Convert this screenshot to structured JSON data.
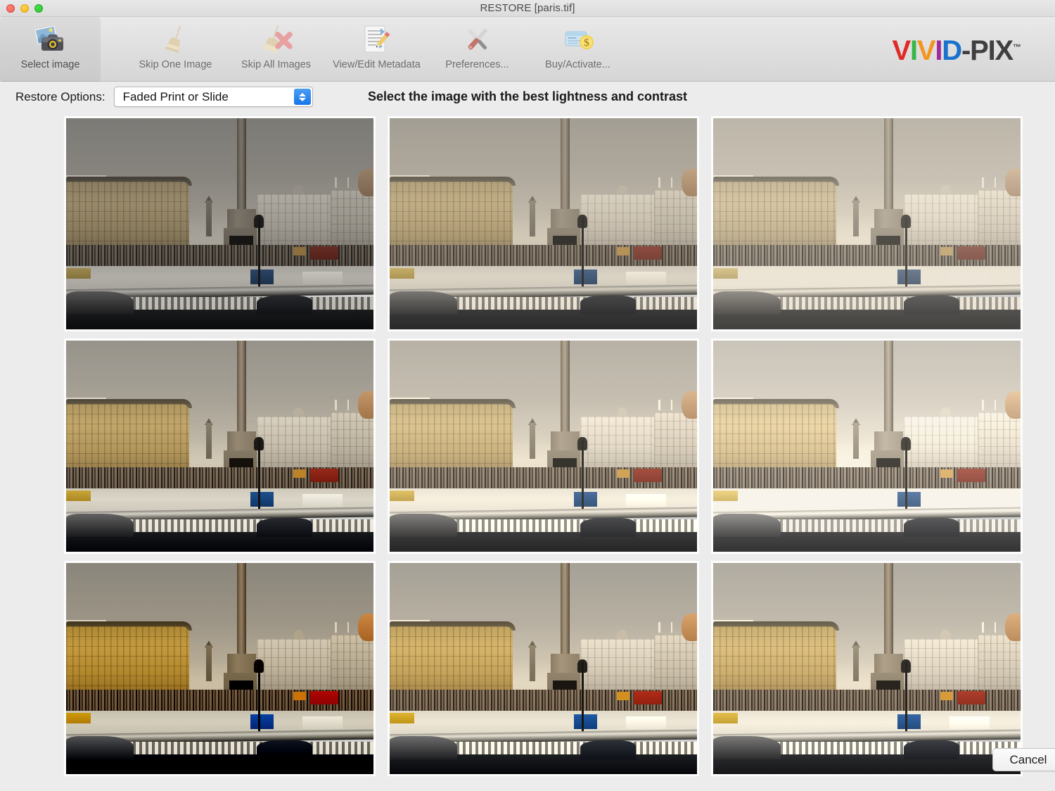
{
  "window": {
    "title": "RESTORE [paris.tif]",
    "controls": {
      "close": "close-button",
      "minimize": "minimize-button",
      "maximize": "maximize-button"
    }
  },
  "toolbar": {
    "items": [
      {
        "label": "Select image",
        "icon": "photo-camera-icon",
        "selected": true
      },
      {
        "label": "Skip One Image",
        "icon": "broom-icon",
        "selected": false
      },
      {
        "label": "Skip All Images",
        "icon": "broom-x-icon",
        "selected": false
      },
      {
        "label": "View/Edit Metadata",
        "icon": "document-pencil-icon",
        "selected": false
      },
      {
        "label": "Preferences...",
        "icon": "tools-icon",
        "selected": false
      },
      {
        "label": "Buy/Activate...",
        "icon": "credit-card-dollar-icon",
        "selected": false
      }
    ],
    "logo": {
      "letters": [
        {
          "char": "V",
          "color": "#e12a26"
        },
        {
          "char": "I",
          "color": "#3ab54a"
        },
        {
          "char": "V",
          "color": "#f5951e"
        },
        {
          "char": "I",
          "color": "#a0299b"
        },
        {
          "char": "D",
          "color": "#1a72cc"
        },
        {
          "char": "-",
          "color": "#3f3f3f"
        },
        {
          "char": "P",
          "color": "#3f3f3f"
        },
        {
          "char": "I",
          "color": "#3f3f3f"
        },
        {
          "char": "X",
          "color": "#3f3f3f"
        }
      ],
      "trademark": "™"
    }
  },
  "options": {
    "restore_label": "Restore Options:",
    "restore_value": "Faded Print or Slide",
    "restore_choices": [
      "Faded Print or Slide"
    ],
    "instruction": "Select the image with the best lightness and contrast"
  },
  "grid": {
    "rows": 3,
    "columns": 3,
    "variants": [
      {
        "position": "top-left",
        "name": "variant-1",
        "brightness": 0.8,
        "contrast": 1.12,
        "saturation": 0.62,
        "sepia": 0.05,
        "hue": 0
      },
      {
        "position": "top-center",
        "name": "variant-2",
        "brightness": 1.02,
        "contrast": 0.9,
        "saturation": 0.78,
        "sepia": 0.18,
        "hue": 0
      },
      {
        "position": "top-right",
        "name": "variant-3",
        "brightness": 1.26,
        "contrast": 0.72,
        "saturation": 0.58,
        "sepia": 0.22,
        "hue": 0
      },
      {
        "position": "middle-left",
        "name": "variant-4",
        "brightness": 0.93,
        "contrast": 1.24,
        "saturation": 0.95,
        "sepia": 0.08,
        "hue": 0
      },
      {
        "position": "middle-center",
        "name": "variant-5",
        "brightness": 1.14,
        "contrast": 0.96,
        "saturation": 0.85,
        "sepia": 0.16,
        "hue": 0
      },
      {
        "position": "middle-right",
        "name": "variant-6",
        "brightness": 1.32,
        "contrast": 0.86,
        "saturation": 0.72,
        "sepia": 0.14,
        "hue": 0
      },
      {
        "position": "bottom-left",
        "name": "variant-7",
        "brightness": 0.86,
        "contrast": 1.45,
        "saturation": 1.35,
        "sepia": 0.06,
        "hue": 0
      },
      {
        "position": "bottom-center",
        "name": "variant-8",
        "brightness": 1.0,
        "contrast": 1.22,
        "saturation": 1.12,
        "sepia": 0.1,
        "hue": 0
      },
      {
        "position": "bottom-right",
        "name": "variant-9",
        "brightness": 1.08,
        "contrast": 1.1,
        "saturation": 1.0,
        "sepia": 0.12,
        "hue": 0
      }
    ]
  },
  "footer": {
    "cancel_label": "Cancel"
  }
}
